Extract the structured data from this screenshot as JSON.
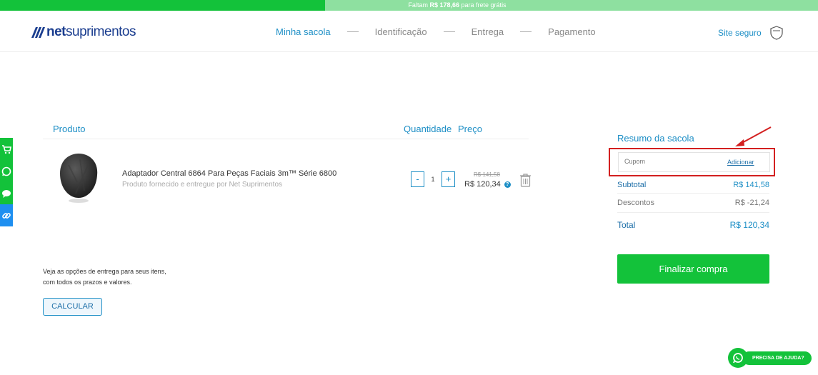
{
  "topbar": {
    "prefix": "Faltam",
    "amount": "R$ 178,66",
    "suffix": "para frete grátis",
    "progress_fraction": 0.397
  },
  "header": {
    "logo_bold": "net",
    "logo_rest": "suprimentos",
    "steps": [
      "Minha sacola",
      "Identificação",
      "Entrega",
      "Pagamento"
    ],
    "active_step": 0,
    "secure_label": "Site seguro"
  },
  "side_buttons": [
    {
      "icon": "cart-icon",
      "color": "#13c23a"
    },
    {
      "icon": "whatsapp-icon",
      "color": "#13c23a"
    },
    {
      "icon": "chat-icon",
      "color": "#13c23a"
    },
    {
      "icon": "link-icon",
      "color": "#1e8ff0"
    }
  ],
  "table": {
    "col_product": "Produto",
    "col_quantity": "Quantidade",
    "col_price": "Preço"
  },
  "item": {
    "name": "Adaptador Central 6864 Para Peças Faciais 3m™ Série 6800",
    "seller": "Produto fornecido e entregue por Net Suprimentos",
    "quantity": "1",
    "minus": "-",
    "plus": "+",
    "old_price": "R$ 141,58",
    "price": "R$ 120,34",
    "info": "?"
  },
  "shipping": {
    "line1": "Veja as opções de entrega para seus itens,",
    "line2": "com todos os prazos e valores.",
    "button": "CALCULAR"
  },
  "summary": {
    "title": "Resumo da sacola",
    "coupon_placeholder": "Cupom",
    "coupon_add": "Adicionar",
    "subtotal_label": "Subtotal",
    "subtotal_value": "R$ 141,58",
    "discount_label": "Descontos",
    "discount_value": "R$ -21,24",
    "total_label": "Total",
    "total_value": "R$ 120,34",
    "finish_button": "Finalizar compra"
  },
  "help": {
    "label": "PRECISA DE AJUDA?"
  },
  "colors": {
    "accent": "#1e8fc6",
    "green": "#13c23a",
    "highlight": "#d32020"
  }
}
